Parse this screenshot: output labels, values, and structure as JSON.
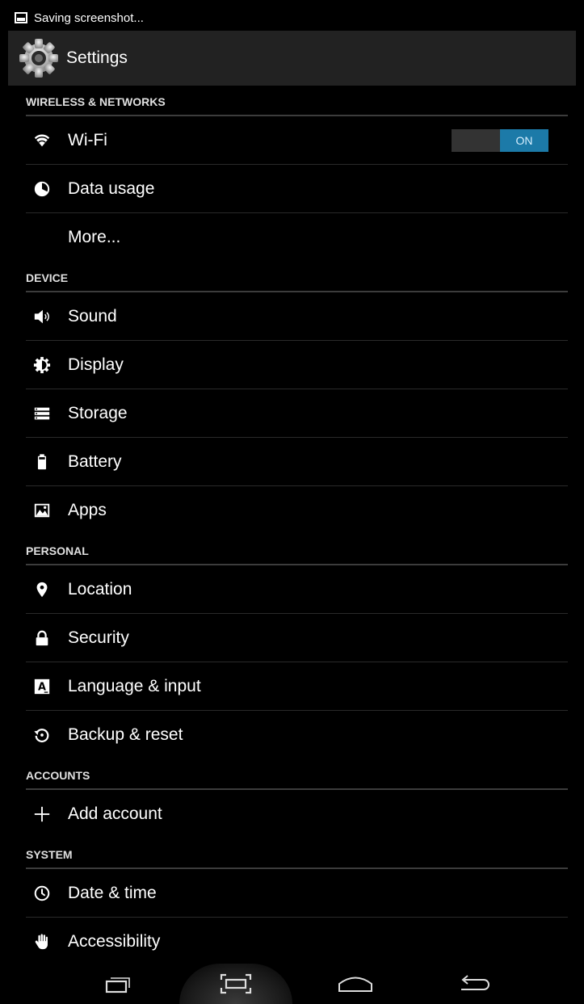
{
  "status_bar": {
    "notification_text": "Saving screenshot..."
  },
  "action_bar": {
    "title": "Settings",
    "icon": "settings-gear-icon"
  },
  "sections": {
    "wireless": "WIRELESS & NETWORKS",
    "device": "DEVICE",
    "personal": "PERSONAL",
    "accounts": "ACCOUNTS",
    "system": "SYSTEM"
  },
  "items": {
    "wifi": {
      "label": "Wi-Fi",
      "icon": "wifi-icon",
      "toggle_state": "ON"
    },
    "data_usage": {
      "label": "Data usage",
      "icon": "data-usage-icon"
    },
    "more": {
      "label": "More..."
    },
    "sound": {
      "label": "Sound",
      "icon": "sound-icon"
    },
    "display": {
      "label": "Display",
      "icon": "display-icon"
    },
    "storage": {
      "label": "Storage",
      "icon": "storage-icon"
    },
    "battery": {
      "label": "Battery",
      "icon": "battery-icon"
    },
    "apps": {
      "label": "Apps",
      "icon": "apps-icon"
    },
    "location": {
      "label": "Location",
      "icon": "location-icon"
    },
    "security": {
      "label": "Security",
      "icon": "lock-icon"
    },
    "language": {
      "label": "Language & input",
      "icon": "language-icon"
    },
    "backup": {
      "label": "Backup & reset",
      "icon": "backup-icon"
    },
    "add_account": {
      "label": "Add account",
      "icon": "plus-icon"
    },
    "date_time": {
      "label": "Date & time",
      "icon": "clock-icon"
    },
    "accessibility": {
      "label": "Accessibility",
      "icon": "hand-icon"
    }
  },
  "colors": {
    "toggle_on": "#1c7aa8",
    "action_bar": "#222222",
    "background": "#000000"
  }
}
